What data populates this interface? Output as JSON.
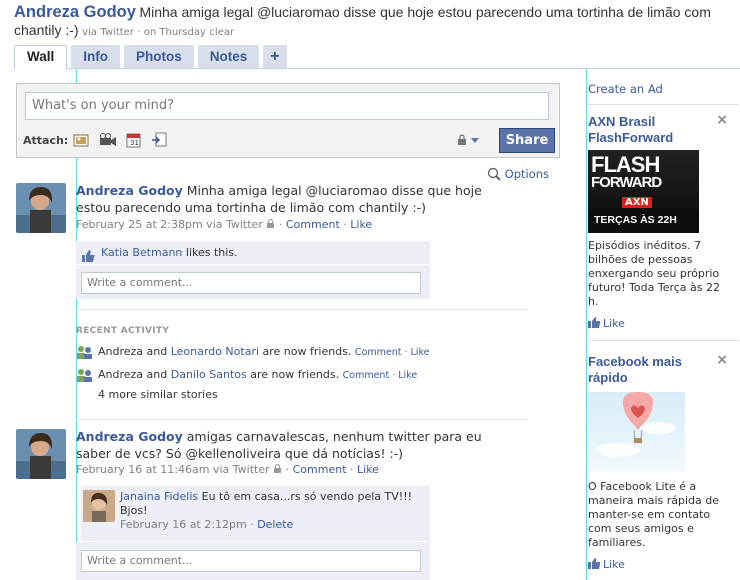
{
  "header": {
    "name": "Andreza Godoy",
    "status": "Minha amiga legal @luciaromao disse que hoje estou parecendo uma tortinha de limão com chantily :-)",
    "via": "via",
    "via_app": "Twitter",
    "when": "· on Thursday",
    "clear": "clear"
  },
  "tabs": [
    {
      "label": "Wall"
    },
    {
      "label": "Info"
    },
    {
      "label": "Photos"
    },
    {
      "label": "Notes"
    },
    {
      "label": "+"
    }
  ],
  "publisher": {
    "placeholder": "What's on your mind?",
    "attach_label": "Attach:",
    "share_label": "Share"
  },
  "options_label": "Options",
  "stories": [
    {
      "name": "Andreza Godoy",
      "text": "Minha amiga legal @luciaromao disse que hoje estou parecendo uma tortinha de limão com chantily :-)",
      "time": "February 25 at 2:38pm via Twitter",
      "comment_label": "Comment",
      "like_label": "Like",
      "liker": "Katia Betmann",
      "likes_text": "likes this.",
      "comment_placeholder": "Write a comment..."
    },
    {
      "name": "Andreza Godoy",
      "text": "amigas carnavalescas, nenhum twitter para eu saber de vcs? Só @kellenoliveira que dá notícias! :-)",
      "time": "February 16 at 11:46am via Twitter",
      "comment_label": "Comment",
      "like_label": "Like",
      "comment": {
        "author": "Janaina Fidelis",
        "text": "Eu tô em casa...rs só vendo pela TV!!! Bjos!",
        "time": "February 16 at 2:12pm",
        "delete_label": "Delete"
      },
      "comment_placeholder": "Write a comment..."
    }
  ],
  "recent_activity": {
    "label": "RECENT ACTIVITY",
    "items": [
      {
        "who": "Andreza and",
        "friend": "Leonardo Notari",
        "what": "are now friends.",
        "comment": "Comment",
        "like": "Like"
      },
      {
        "who": "Andreza and",
        "friend": "Danilo Santos",
        "what": "are now friends.",
        "comment": "Comment",
        "like": "Like"
      }
    ],
    "more": "4 more similar stories"
  },
  "sidebar": {
    "create_ad": "Create an Ad",
    "ads": [
      {
        "title": "AXN Brasil FlashForward",
        "image_text": [
          "FLASH",
          "FORWARD",
          "AXN",
          "TERÇAS ÀS 22H"
        ],
        "body": "Episódios inéditos. 7 bilhões de pessoas enxergando seu próprio futuro! Toda Terça às 22 h.",
        "like": "Like"
      },
      {
        "title": "Facebook mais rápido",
        "body": "O Facebook Lite é a maneira mais rápida de manter-se em contato com seus amigos e familiares.",
        "like": "Like"
      }
    ]
  },
  "colors": {
    "fb_blue": "#3b5998",
    "tab_bg": "#d8dfea",
    "share_bg": "#5b74a8",
    "ufi_bg": "#eceff5",
    "guide": "#5de0e0"
  }
}
